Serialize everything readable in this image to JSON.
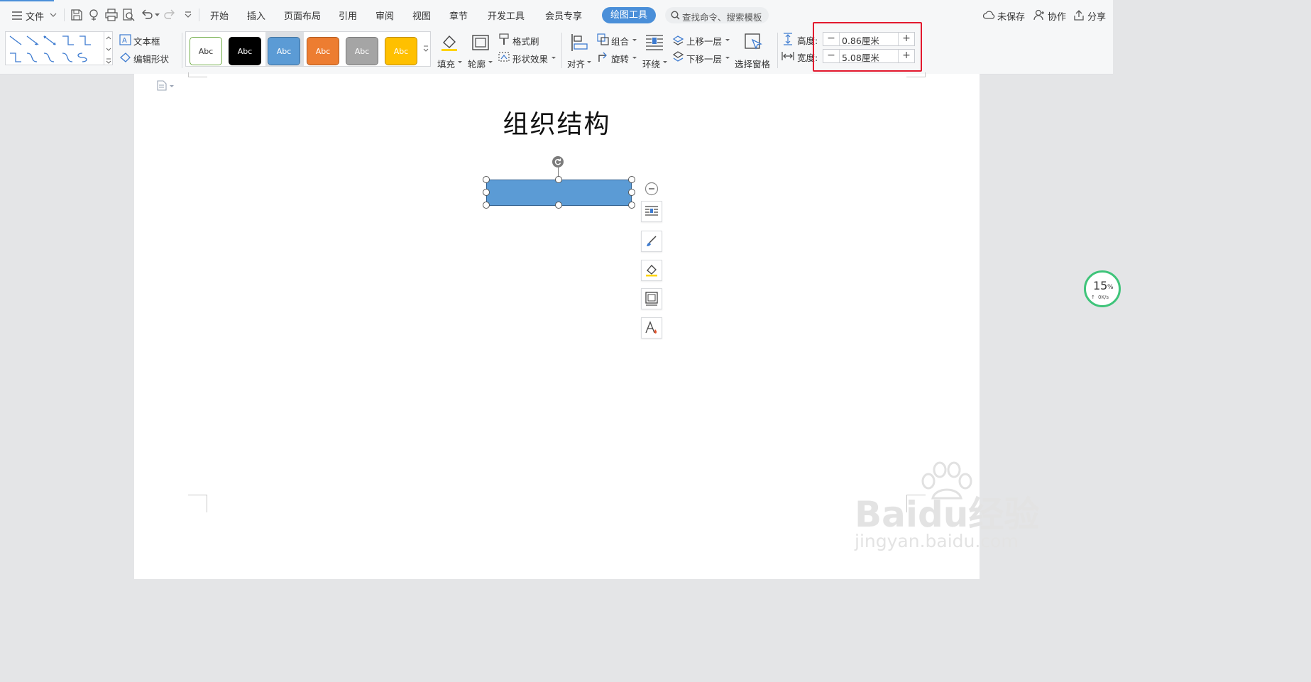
{
  "menu": {
    "file_label": "文件",
    "tabs": [
      "开始",
      "插入",
      "页面布局",
      "引用",
      "审阅",
      "视图",
      "章节",
      "开发工具",
      "会员专享"
    ],
    "active_tab": "绘图工具",
    "search_placeholder": "查找命令、搜索模板",
    "right_actions": [
      "未保存",
      "协作",
      "分享"
    ]
  },
  "ribbon": {
    "textbox_label": "文本框",
    "edit_shape_label": "编辑形状",
    "styles": [
      {
        "label": "Abc",
        "bg": "#ffffff",
        "border": "#70ad47",
        "color": "#333333"
      },
      {
        "label": "Abc",
        "bg": "#000000",
        "border": "#000000",
        "color": "#ffffff"
      },
      {
        "label": "Abc",
        "bg": "#5b9bd5",
        "border": "#41719c",
        "color": "#ffffff"
      },
      {
        "label": "Abc",
        "bg": "#ed7d31",
        "border": "#ae5a21",
        "color": "#ffffff"
      },
      {
        "label": "Abc",
        "bg": "#a5a5a5",
        "border": "#787878",
        "color": "#ffffff"
      },
      {
        "label": "Abc",
        "bg": "#ffc000",
        "border": "#bc8c00",
        "color": "#ffffff"
      }
    ],
    "fill_label": "填充",
    "outline_label": "轮廓",
    "format_painter_label": "格式刷",
    "shape_effect_label": "形状效果",
    "align_label": "对齐",
    "group_label": "组合",
    "rotate_label": "旋转",
    "wrap_label": "环绕",
    "bring_forward_label": "上移一层",
    "send_backward_label": "下移一层",
    "selection_pane_label": "选择窗格",
    "height_label": "高度:",
    "height_value": "0.86厘米",
    "width_label": "宽度:",
    "width_value": "5.08厘米"
  },
  "document": {
    "title": "组织结构"
  },
  "shape": {
    "fill": "#5b9bd5",
    "border": "#2f5f8f"
  },
  "speed": {
    "percent": "15",
    "percent_sign": "%",
    "rate": "0K/s"
  },
  "watermark": {
    "brand": "Baidu经验",
    "url": "jingyan.baidu.com"
  }
}
